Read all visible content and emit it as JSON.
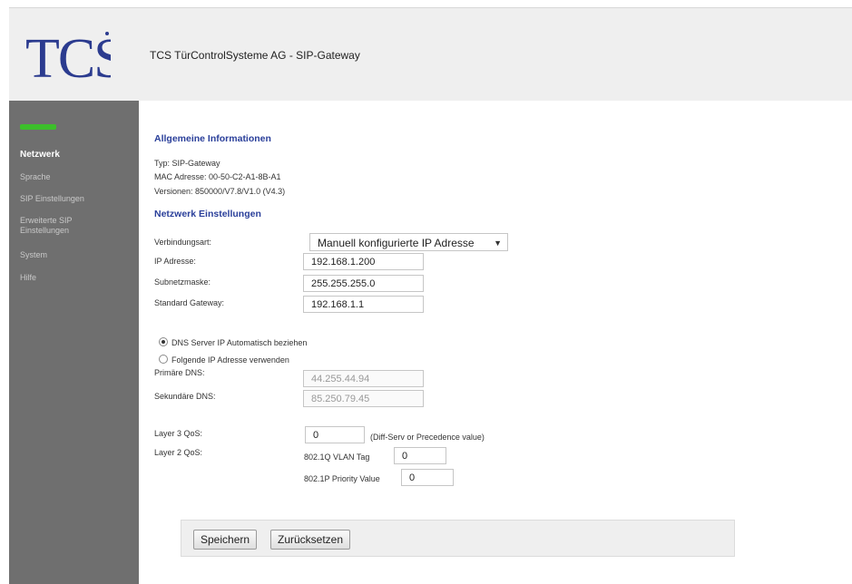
{
  "header": {
    "logo_text": "TCS",
    "title": "TCS TürControlSysteme AG - SIP-Gateway"
  },
  "sidebar": {
    "items": [
      {
        "label": "Netzwerk"
      },
      {
        "label": "Sprache"
      },
      {
        "label": "SIP Einstellungen"
      },
      {
        "label": "Erweiterte SIP Einstellungen"
      },
      {
        "label": "System"
      },
      {
        "label": "Hilfe"
      }
    ],
    "accent_color": "#3cbf2a"
  },
  "general": {
    "title": "Allgemeine Informationen",
    "type_line": "Typ: SIP-Gateway",
    "mac_line": "MAC Adresse: 00-50-C2-A1-8B-A1",
    "version_line": "Versionen: 850000/V7.8/V1.0 (V4.3)"
  },
  "network": {
    "title": "Netzwerk Einstellungen",
    "connection_label": "Verbindungsart:",
    "connection_value": "Manuell konfigurierte IP Adresse",
    "ip_label": "IP Adresse:",
    "ip_value": "192.168.1.200",
    "subnet_label": "Subnetzmaske:",
    "subnet_value": "255.255.255.0",
    "gateway_label": "Standard Gateway:",
    "gateway_value": "192.168.1.1"
  },
  "dns": {
    "auto_label": "DNS Server IP Automatisch beziehen",
    "manual_label": "Folgende IP Adresse verwenden",
    "primary_label": "Primäre DNS:",
    "primary_value": "44.255.44.94",
    "secondary_label": "Sekundäre DNS:",
    "secondary_value": "85.250.79.45"
  },
  "qos": {
    "layer3_label": "Layer 3 QoS:",
    "layer3_value": "0",
    "layer3_hint": "(Diff-Serv or Precedence value)",
    "layer2_label": "Layer 2 QoS:",
    "vlan_label": "802.1Q VLAN Tag",
    "vlan_value": "0",
    "priority_label": "802.1P Priority Value",
    "priority_value": "0"
  },
  "buttons": {
    "save": "Speichern",
    "reset": "Zurücksetzen"
  }
}
